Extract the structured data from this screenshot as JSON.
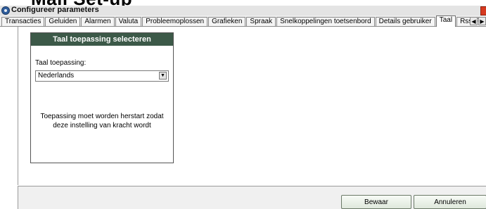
{
  "background_heading": "Mail Set-up",
  "window": {
    "title": "Configureer parameters"
  },
  "tabs": [
    {
      "label": "Transacties",
      "active": false
    },
    {
      "label": "Geluiden",
      "active": false
    },
    {
      "label": "Alarmen",
      "active": false
    },
    {
      "label": "Valuta",
      "active": false
    },
    {
      "label": "Probleemoplossen",
      "active": false
    },
    {
      "label": "Grafieken",
      "active": false
    },
    {
      "label": "Spraak",
      "active": false
    },
    {
      "label": "Snelkoppelingen toetsenbord",
      "active": false
    },
    {
      "label": "Details gebruiker",
      "active": false
    },
    {
      "label": "Taal",
      "active": true
    },
    {
      "label": "Rss Feeds",
      "active": false
    }
  ],
  "language_panel": {
    "header": "Taal toepassing selecteren",
    "field_label": "Taal toepassing:",
    "selected_language": "Nederlands",
    "note": "Toepassing moet worden herstart zodat deze instelling van kracht wordt"
  },
  "footer": {
    "save_label": "Bewaar",
    "cancel_label": "Annuleren"
  },
  "colors": {
    "panel_header": "#3c5948",
    "close_button": "#d63a20"
  }
}
